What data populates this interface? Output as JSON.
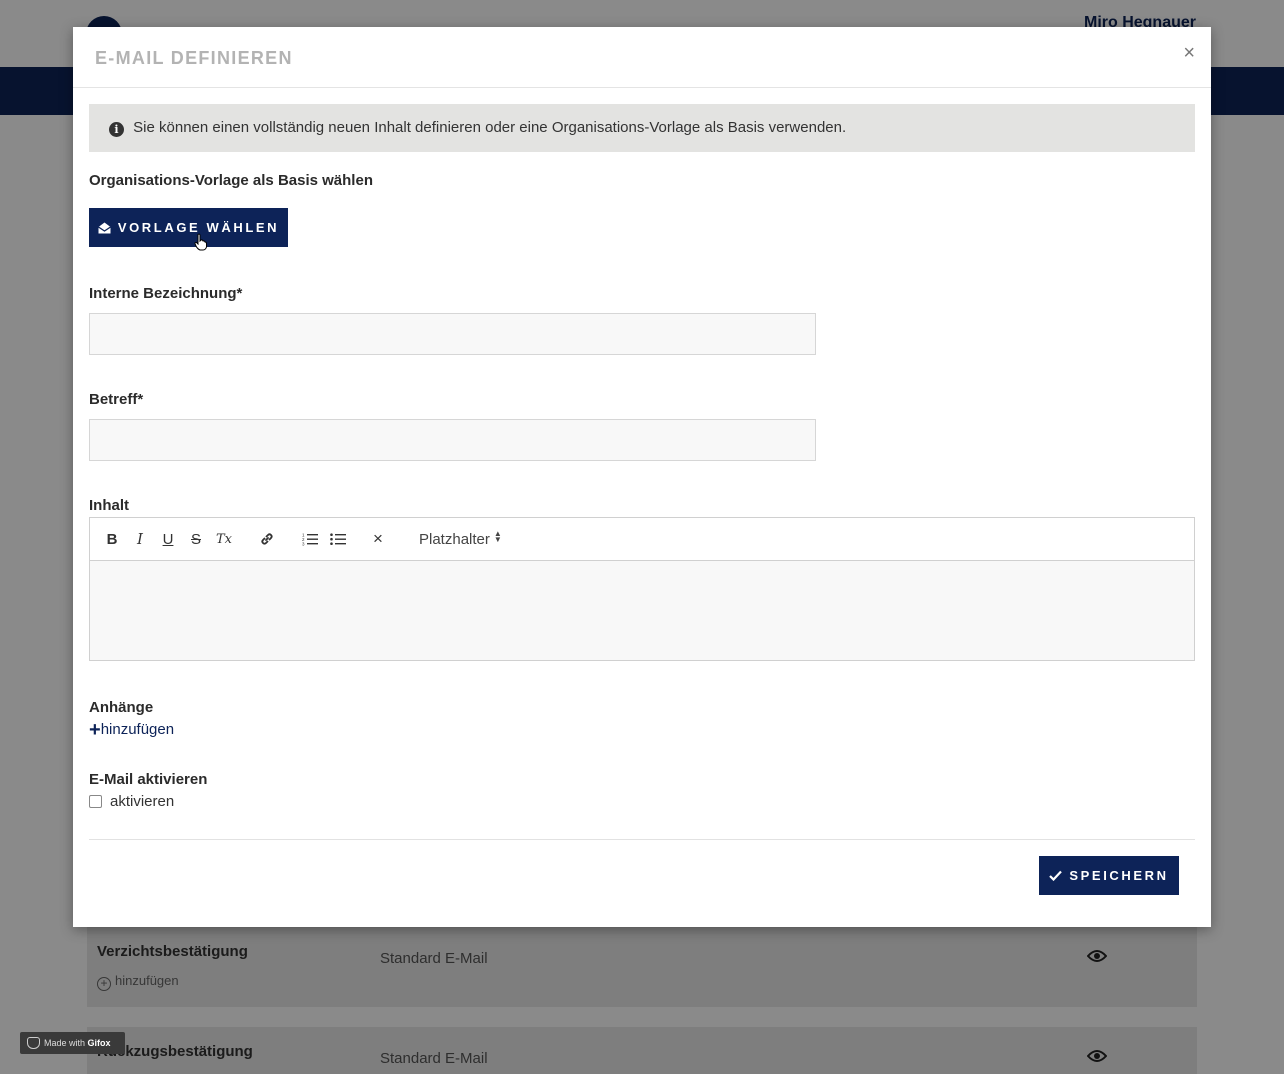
{
  "background": {
    "user_name": "Miro Hegnauer",
    "rows": [
      {
        "name": "Verzichtsbestätigung",
        "add_label": "hinzufügen",
        "type": "Standard E-Mail"
      },
      {
        "name": "Rückzugsbestätigung",
        "add_label": "",
        "type": "Standard E-Mail"
      }
    ]
  },
  "modal": {
    "title": "E-MAIL DEFINIEREN",
    "close_label": "×",
    "info_text": "Sie können einen vollständig neuen Inhalt definieren oder eine Organisations-Vorlage als Basis verwenden.",
    "template_section": {
      "label": "Organisations-Vorlage als Basis wählen",
      "button_label": "VORLAGE WÄHLEN"
    },
    "internal_name": {
      "label": "Interne Bezeichnung*",
      "value": ""
    },
    "subject": {
      "label": "Betreff*",
      "value": ""
    },
    "content": {
      "label": "Inhalt",
      "toolbar": {
        "bold": "B",
        "italic": "I",
        "underline": "U",
        "strike": "S",
        "clear_format": "Tx",
        "remove": "×",
        "placeholder_select": "Platzhalter"
      },
      "value": ""
    },
    "attachments": {
      "label": "Anhänge",
      "add_label": "hinzufügen"
    },
    "activate": {
      "label": "E-Mail aktivieren",
      "checkbox_label": "aktivieren",
      "checked": false
    },
    "save_label": "SPEICHERN"
  },
  "watermark": {
    "prefix": "Made with",
    "brand": "Gifox"
  },
  "colors": {
    "primary": "#0d2358",
    "info_bg": "#e3e3e1",
    "title_gray": "#b3b3b3"
  }
}
